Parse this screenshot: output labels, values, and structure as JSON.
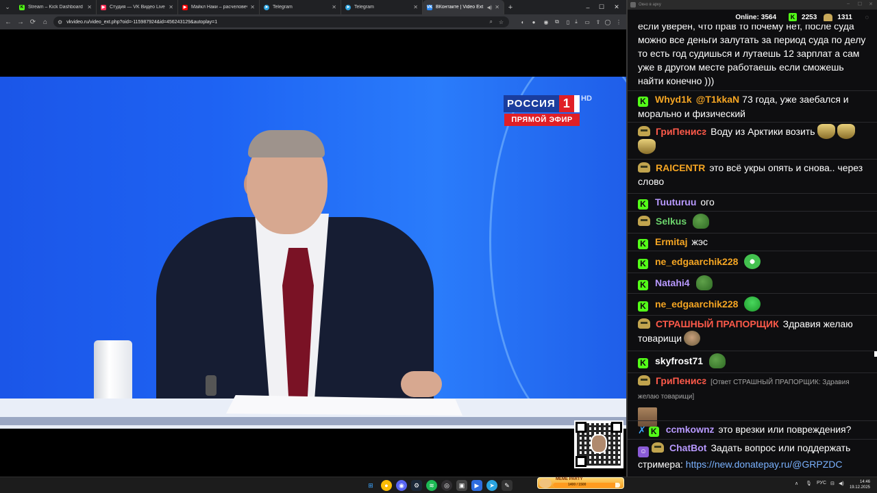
{
  "browser": {
    "tabs": [
      {
        "title": "Stream – Kick Dashboard",
        "favicon": "kick",
        "color": "#53fc18"
      },
      {
        "title": "Студия — VK Видео Live",
        "favicon": "vk-video",
        "color": "#ff2d55"
      },
      {
        "title": "Майкл Наки – расчеловечива",
        "favicon": "youtube",
        "color": "#ff0000"
      },
      {
        "title": "Telegram",
        "favicon": "telegram",
        "color": "#2aa3e0"
      },
      {
        "title": "Telegram",
        "favicon": "telegram",
        "color": "#2aa3e0"
      },
      {
        "title": "ВКонтакте | Video Ext",
        "favicon": "vk",
        "color": "#2787f5",
        "active": true
      }
    ],
    "url": "vkvideo.ru/video_ext.php?oid=-115987924&id=456243129&autoplay=1"
  },
  "video": {
    "channel_name": "РОССИЯ",
    "channel_number": "1",
    "hd": "HD",
    "live_label": "ПРЯМОЙ ЭФИР"
  },
  "chat": {
    "window_title": "Окно в арку",
    "online_label": "Online:",
    "online_count": "3564",
    "kick_count": "2253",
    "other_count": "1311",
    "messages": [
      {
        "badges": [],
        "user": "",
        "user_color": "#ffffff",
        "text": "если уверен, что прав то почему нет, после суда можно все деньги залутать за период суда по делу то есть год судишься и лутаешь 12 зарплат а сам уже в другом месте работаешь если сможешь найти конечно )))",
        "emotes": []
      },
      {
        "badges": [
          "kick"
        ],
        "user": "Whyd1k",
        "user_color": "#f6a623",
        "mention": "@T1kkaN",
        "text": "73 года, уже заебался и морально и физический",
        "emotes": []
      },
      {
        "badges": [
          "bot-face"
        ],
        "user": "ГриПенисᴤ",
        "user_color": "#ff5a4a",
        "text": "Воду из Арктики возить",
        "emotes": [
          "gold",
          "gold",
          "gold"
        ]
      },
      {
        "badges": [
          "bot-face"
        ],
        "user": "RAICENTR",
        "user_color": "#f6a623",
        "text": "это всё укры опять и снова.. через слово",
        "emotes": []
      },
      {
        "badges": [
          "kick"
        ],
        "user": "Tuuturuu",
        "user_color": "#b899ff",
        "text": "ого",
        "emotes": []
      },
      {
        "badges": [
          "bot-face"
        ],
        "user": "Selkus",
        "user_color": "#6cd36c",
        "text": "",
        "emotes": [
          "pepe"
        ]
      },
      {
        "badges": [
          "kick"
        ],
        "user": "Ermitaj",
        "user_color": "#f6a623",
        "text": "жэс",
        "emotes": []
      },
      {
        "badges": [
          "kick"
        ],
        "user": "ne_edgaarchik228",
        "user_color": "#f6a623",
        "text": "",
        "emotes": [
          "eyes"
        ]
      },
      {
        "badges": [
          "kick"
        ],
        "user": "Natahi4",
        "user_color": "#b899ff",
        "text": "",
        "emotes": [
          "pepe"
        ]
      },
      {
        "badges": [
          "kick"
        ],
        "user": "ne_edgaarchik228",
        "user_color": "#f6a623",
        "text": "",
        "emotes": [
          "slime"
        ]
      },
      {
        "badges": [
          "bot-face"
        ],
        "user": "СТРАШНЫЙ ПРАПОРЩИК",
        "user_color": "#ff5a4a",
        "text": "Здравия желаю товарищи",
        "emotes": [
          "face"
        ]
      },
      {
        "badges": [
          "kick"
        ],
        "user": "skyfrost71",
        "user_color": "#ffffff",
        "text": "",
        "emotes": [
          "pepe"
        ]
      },
      {
        "badges": [
          "bot-face"
        ],
        "user": "ГриПенисᴤ",
        "user_color": "#ff5a4a",
        "reply": "[Ответ СТРАШНЫЙ ПРАПОРЩИК: Здравия желаю товарищи]",
        "text": "",
        "emotes": [],
        "has_image": true
      },
      {
        "badges": [
          "sword",
          "kick"
        ],
        "user": "ccmkownz",
        "user_color": "#b899ff",
        "text": "это врезки или повреждения?",
        "emotes": []
      },
      {
        "badges": [
          "bot",
          "bot-face"
        ],
        "user": "ChatBot",
        "user_color": "#b899ff",
        "text": "Задать вопрос или поддержать стримера:",
        "link": "https://new.donatepay.ru/@GRPZDC",
        "emotes": []
      }
    ]
  },
  "taskbar": {
    "meme_party_label": "MEME PARTY",
    "meme_progress_text": "1400 / 1500",
    "meme_progress": 0.93,
    "language": "РУС",
    "time": "14:46",
    "date": "19.12.2025"
  }
}
